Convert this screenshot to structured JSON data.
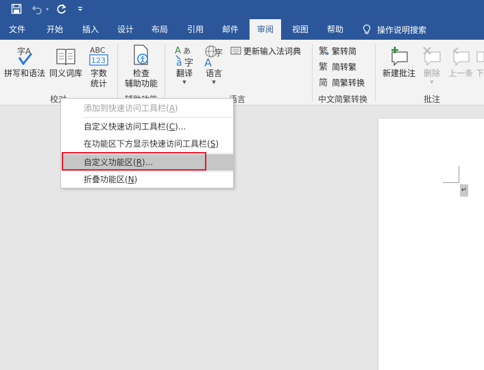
{
  "qat": {
    "save_icon": "save-icon",
    "undo_icon": "undo-icon",
    "redo_icon": "redo-icon",
    "customize_icon": "customize-qat-icon"
  },
  "tabs": [
    {
      "label": "文件",
      "active": false
    },
    {
      "label": "开始",
      "active": false
    },
    {
      "label": "插入",
      "active": false
    },
    {
      "label": "设计",
      "active": false
    },
    {
      "label": "布局",
      "active": false
    },
    {
      "label": "引用",
      "active": false
    },
    {
      "label": "邮件",
      "active": false
    },
    {
      "label": "审阅",
      "active": true
    },
    {
      "label": "视图",
      "active": false
    },
    {
      "label": "帮助",
      "active": false
    }
  ],
  "tell_me": "操作说明搜索",
  "ribbon": {
    "proofing": {
      "spelling": "拼写和语法",
      "thesaurus": "同义词库",
      "word_count_line1": "字数",
      "word_count_line2": "统计",
      "label": "校对"
    },
    "accessibility": {
      "check_line1": "检查",
      "check_line2": "辅助功能",
      "label": "辅助功能"
    },
    "language": {
      "translate": "翻译",
      "language": "语言",
      "update_ime": "更新输入法词典",
      "label": "语言"
    },
    "chinese_conversion": {
      "to_simplified": "繁转简",
      "to_traditional": "简转繁",
      "convert": "简繁转换",
      "label": "中文简繁转换"
    },
    "comments": {
      "new": "新建批注",
      "delete": "删除",
      "previous": "上一条",
      "next_partial": "下",
      "label": "批注"
    }
  },
  "context_menu": {
    "items": [
      {
        "text": "添加到快速访问工具栏(",
        "key": "A",
        "tail": ")",
        "disabled": true
      },
      {
        "text": "自定义快速访问工具栏(",
        "key": "C",
        "tail": ")...",
        "disabled": false
      },
      {
        "text": "在功能区下方显示快速访问工具栏(",
        "key": "S",
        "tail": ")",
        "disabled": false
      },
      {
        "text": "自定义功能区(",
        "key": "R",
        "tail": ")...",
        "disabled": false,
        "highlighted": true
      },
      {
        "text": "折叠功能区(",
        "key": "N",
        "tail": ")",
        "disabled": false
      }
    ]
  },
  "document": {
    "paragraph_mark": "↵"
  },
  "colors": {
    "title_bar": "#2b579a",
    "ribbon_bg": "#f3f3f3",
    "highlight_box": "#e81123",
    "menu_hover": "#c6c6c6"
  }
}
